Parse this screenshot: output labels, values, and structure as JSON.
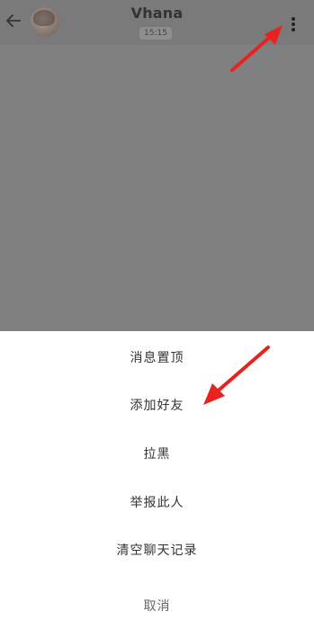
{
  "header": {
    "title": "Vhana",
    "time": "15:15",
    "back_icon": "arrow-left-icon",
    "more_icon": "vertical-dots-icon"
  },
  "action_sheet": {
    "items": [
      {
        "label": "消息置顶"
      },
      {
        "label": "添加好友"
      },
      {
        "label": "拉黑"
      },
      {
        "label": "举报此人"
      },
      {
        "label": "清空聊天记录"
      }
    ],
    "cancel_label": "取消"
  },
  "colors": {
    "overlay": "#808080",
    "annotation_arrow": "#e8231f",
    "sheet_background": "#ffffff"
  }
}
